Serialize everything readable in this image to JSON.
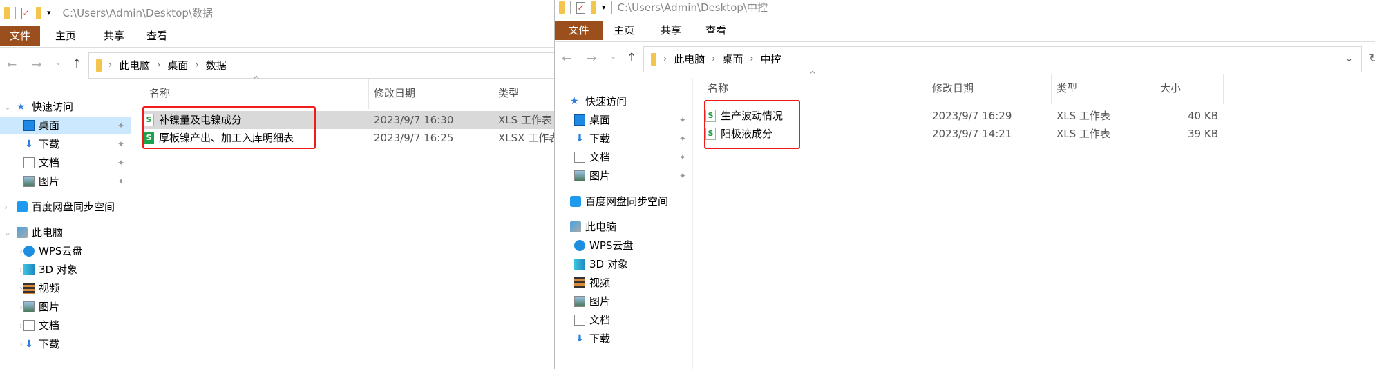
{
  "left": {
    "path": "C:\\Users\\Admin\\Desktop\\数据",
    "tabs": [
      "文件",
      "主页",
      "共享",
      "查看"
    ],
    "breadcrumb": [
      "此电脑",
      "桌面",
      "数据"
    ],
    "columns": [
      "名称",
      "修改日期",
      "类型"
    ],
    "files": [
      {
        "name": "补镍量及电镍成分",
        "date": "2023/9/7 16:30",
        "type": "XLS 工作表",
        "icon": "wps-sheet-icon",
        "selected": true
      },
      {
        "name": "厚板镍产出、加工入库明细表",
        "date": "2023/9/7 16:25",
        "type": "XLSX 工作表",
        "icon": "wps-sheet-solid-icon",
        "selected": false
      }
    ],
    "sidebar": [
      {
        "label": "快速访问",
        "icon": "star",
        "level": 0,
        "exp": "v"
      },
      {
        "label": "桌面",
        "icon": "desktop",
        "level": 1,
        "pin": true,
        "sel": true
      },
      {
        "label": "下载",
        "icon": "download",
        "level": 1,
        "pin": true
      },
      {
        "label": "文档",
        "icon": "doc",
        "level": 1,
        "pin": true
      },
      {
        "label": "图片",
        "icon": "pic",
        "level": 1,
        "pin": true
      },
      {
        "label": "百度网盘同步空间",
        "icon": "baidu",
        "level": 0,
        "exp": ">",
        "gap": true
      },
      {
        "label": "此电脑",
        "icon": "pc",
        "level": 0,
        "exp": "v",
        "gap": true
      },
      {
        "label": "WPS云盘",
        "icon": "cloud",
        "level": 1,
        "exp": ">"
      },
      {
        "label": "3D 对象",
        "icon": "cube",
        "level": 1,
        "exp": ">"
      },
      {
        "label": "视频",
        "icon": "video",
        "level": 1,
        "exp": ">"
      },
      {
        "label": "图片",
        "icon": "pic",
        "level": 1,
        "exp": ">"
      },
      {
        "label": "文档",
        "icon": "doc",
        "level": 1,
        "exp": ">"
      },
      {
        "label": "下载",
        "icon": "download",
        "level": 1,
        "exp": ">"
      }
    ]
  },
  "right": {
    "path": "C:\\Users\\Admin\\Desktop\\中控",
    "tabs": [
      "文件",
      "主页",
      "共享",
      "查看"
    ],
    "breadcrumb": [
      "此电脑",
      "桌面",
      "中控"
    ],
    "columns": [
      "名称",
      "修改日期",
      "类型",
      "大小"
    ],
    "files": [
      {
        "name": "生产波动情况",
        "date": "2023/9/7 16:29",
        "type": "XLS 工作表",
        "size": "40 KB",
        "icon": "wps-sheet-icon"
      },
      {
        "name": "阳极液成分",
        "date": "2023/9/7 14:21",
        "type": "XLS 工作表",
        "size": "39 KB",
        "icon": "wps-sheet-icon"
      }
    ],
    "sidebar": [
      {
        "label": "快速访问",
        "icon": "star",
        "level": 0
      },
      {
        "label": "桌面",
        "icon": "desktop",
        "level": 1,
        "pin": true
      },
      {
        "label": "下载",
        "icon": "download",
        "level": 1,
        "pin": true
      },
      {
        "label": "文档",
        "icon": "doc",
        "level": 1,
        "pin": true
      },
      {
        "label": "图片",
        "icon": "pic",
        "level": 1,
        "pin": true
      },
      {
        "label": "百度网盘同步空间",
        "icon": "baidu",
        "level": 0,
        "gap": true
      },
      {
        "label": "此电脑",
        "icon": "pc",
        "level": 0,
        "gap": true
      },
      {
        "label": "WPS云盘",
        "icon": "cloud",
        "level": 1
      },
      {
        "label": "3D 对象",
        "icon": "cube",
        "level": 1
      },
      {
        "label": "视频",
        "icon": "video",
        "level": 1
      },
      {
        "label": "图片",
        "icon": "pic",
        "level": 1
      },
      {
        "label": "文档",
        "icon": "doc",
        "level": 1
      },
      {
        "label": "下载",
        "icon": "download",
        "level": 1
      }
    ]
  },
  "colors": {
    "file_tab": "#9b4f1d",
    "selected_nav": "#cce8ff",
    "selected_row": "#d9d9d9",
    "highlight_box": "#f01c1c",
    "folder": "#f3c54d"
  }
}
